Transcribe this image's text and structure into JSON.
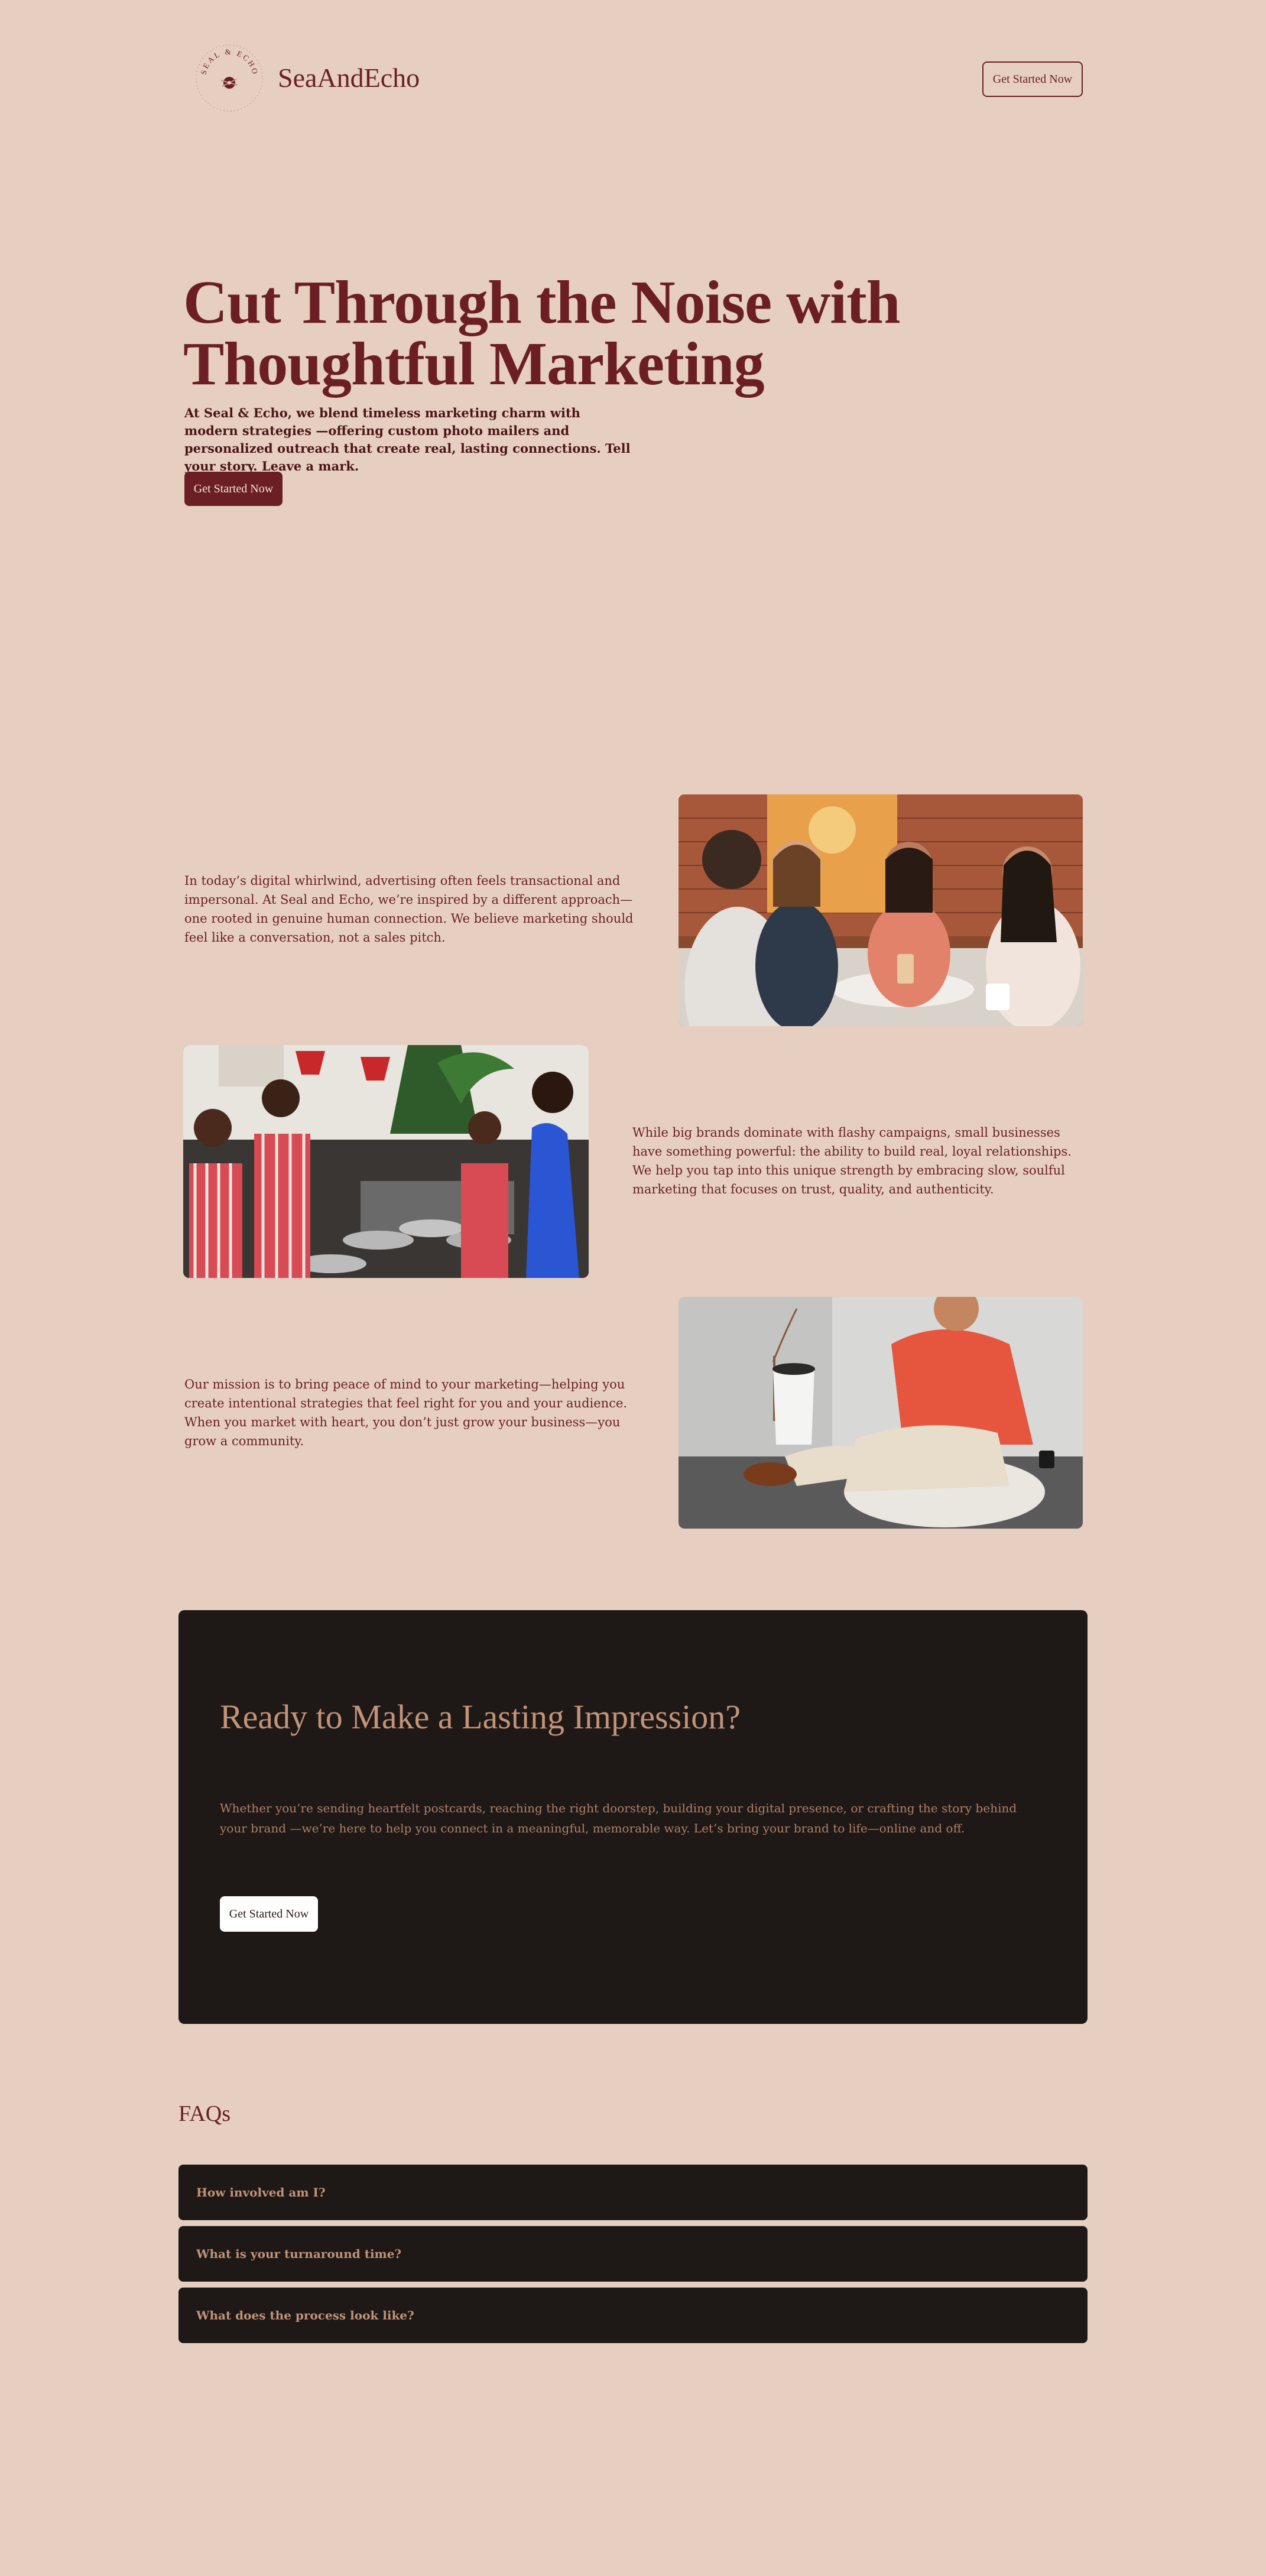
{
  "header": {
    "logo_text": "SEAL & ECHO",
    "brand_name": "SeaAndEcho",
    "cta_label": "Get Started Now"
  },
  "hero": {
    "title": "Cut Through the Noise with Thoughtful Marketing",
    "subtitle": "At Seal & Echo, we blend timeless marketing charm with modern strategies —offering custom photo mailers and personalized outreach that create real, lasting connections. Tell your story. Leave a mark.",
    "cta_label": "Get Started Now"
  },
  "story": [
    {
      "text": "In today’s digital whirlwind, advertising often feels transactional and impersonal. At Seal and Echo, we’re inspired by a different approach—one rooted in genuine human connection. We believe marketing should feel like a conversation, not a sales pitch.",
      "image": "women-at-cafe-photo"
    },
    {
      "text": "While big brands dominate with flashy campaigns, small businesses have something powerful: the ability to build real, loyal relationships. We help you tap into this unique strength by embracing slow, soulful marketing that focuses on trust, quality, and authenticity.",
      "image": "restaurant-staff-photo"
    },
    {
      "text": "Our mission is to bring peace of mind to your marketing—helping you create intentional strategies that feel right for you and your audience. When you market with heart, you don’t just grow your business—you grow a community.",
      "image": "man-in-chair-photo"
    }
  ],
  "cta": {
    "title": "Ready to Make a Lasting Impression?",
    "text": "Whether you’re sending heartfelt postcards, reaching the right doorstep, building your digital presence, or crafting the story behind your brand —we’re here to help you connect in a meaningful, memorable way. Let’s bring your brand to life—online and off.",
    "button_label": "Get Started Now"
  },
  "faq": {
    "heading": "FAQs",
    "items": [
      {
        "question": "How involved am I?"
      },
      {
        "question": "What is your turnaround time?"
      },
      {
        "question": "What does the process look like?"
      }
    ]
  },
  "colors": {
    "background": "#e6cfc1",
    "brand": "#6b1f24",
    "dark_panel": "#1e1816",
    "accent_text": "#c29377"
  }
}
